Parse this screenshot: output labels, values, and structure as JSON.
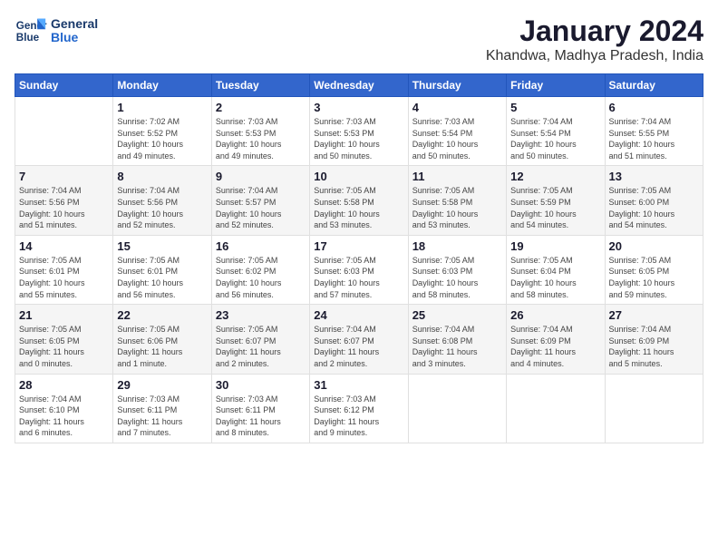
{
  "app": {
    "name": "GeneralBlue",
    "logo_line1": "General",
    "logo_line2": "Blue"
  },
  "calendar": {
    "month": "January 2024",
    "location": "Khandwa, Madhya Pradesh, India",
    "weekdays": [
      "Sunday",
      "Monday",
      "Tuesday",
      "Wednesday",
      "Thursday",
      "Friday",
      "Saturday"
    ],
    "weeks": [
      [
        {
          "day": "",
          "info": ""
        },
        {
          "day": "1",
          "info": "Sunrise: 7:02 AM\nSunset: 5:52 PM\nDaylight: 10 hours\nand 49 minutes."
        },
        {
          "day": "2",
          "info": "Sunrise: 7:03 AM\nSunset: 5:53 PM\nDaylight: 10 hours\nand 49 minutes."
        },
        {
          "day": "3",
          "info": "Sunrise: 7:03 AM\nSunset: 5:53 PM\nDaylight: 10 hours\nand 50 minutes."
        },
        {
          "day": "4",
          "info": "Sunrise: 7:03 AM\nSunset: 5:54 PM\nDaylight: 10 hours\nand 50 minutes."
        },
        {
          "day": "5",
          "info": "Sunrise: 7:04 AM\nSunset: 5:54 PM\nDaylight: 10 hours\nand 50 minutes."
        },
        {
          "day": "6",
          "info": "Sunrise: 7:04 AM\nSunset: 5:55 PM\nDaylight: 10 hours\nand 51 minutes."
        }
      ],
      [
        {
          "day": "7",
          "info": "Sunrise: 7:04 AM\nSunset: 5:56 PM\nDaylight: 10 hours\nand 51 minutes."
        },
        {
          "day": "8",
          "info": "Sunrise: 7:04 AM\nSunset: 5:56 PM\nDaylight: 10 hours\nand 52 minutes."
        },
        {
          "day": "9",
          "info": "Sunrise: 7:04 AM\nSunset: 5:57 PM\nDaylight: 10 hours\nand 52 minutes."
        },
        {
          "day": "10",
          "info": "Sunrise: 7:05 AM\nSunset: 5:58 PM\nDaylight: 10 hours\nand 53 minutes."
        },
        {
          "day": "11",
          "info": "Sunrise: 7:05 AM\nSunset: 5:58 PM\nDaylight: 10 hours\nand 53 minutes."
        },
        {
          "day": "12",
          "info": "Sunrise: 7:05 AM\nSunset: 5:59 PM\nDaylight: 10 hours\nand 54 minutes."
        },
        {
          "day": "13",
          "info": "Sunrise: 7:05 AM\nSunset: 6:00 PM\nDaylight: 10 hours\nand 54 minutes."
        }
      ],
      [
        {
          "day": "14",
          "info": "Sunrise: 7:05 AM\nSunset: 6:01 PM\nDaylight: 10 hours\nand 55 minutes."
        },
        {
          "day": "15",
          "info": "Sunrise: 7:05 AM\nSunset: 6:01 PM\nDaylight: 10 hours\nand 56 minutes."
        },
        {
          "day": "16",
          "info": "Sunrise: 7:05 AM\nSunset: 6:02 PM\nDaylight: 10 hours\nand 56 minutes."
        },
        {
          "day": "17",
          "info": "Sunrise: 7:05 AM\nSunset: 6:03 PM\nDaylight: 10 hours\nand 57 minutes."
        },
        {
          "day": "18",
          "info": "Sunrise: 7:05 AM\nSunset: 6:03 PM\nDaylight: 10 hours\nand 58 minutes."
        },
        {
          "day": "19",
          "info": "Sunrise: 7:05 AM\nSunset: 6:04 PM\nDaylight: 10 hours\nand 58 minutes."
        },
        {
          "day": "20",
          "info": "Sunrise: 7:05 AM\nSunset: 6:05 PM\nDaylight: 10 hours\nand 59 minutes."
        }
      ],
      [
        {
          "day": "21",
          "info": "Sunrise: 7:05 AM\nSunset: 6:05 PM\nDaylight: 11 hours\nand 0 minutes."
        },
        {
          "day": "22",
          "info": "Sunrise: 7:05 AM\nSunset: 6:06 PM\nDaylight: 11 hours\nand 1 minute."
        },
        {
          "day": "23",
          "info": "Sunrise: 7:05 AM\nSunset: 6:07 PM\nDaylight: 11 hours\nand 2 minutes."
        },
        {
          "day": "24",
          "info": "Sunrise: 7:04 AM\nSunset: 6:07 PM\nDaylight: 11 hours\nand 2 minutes."
        },
        {
          "day": "25",
          "info": "Sunrise: 7:04 AM\nSunset: 6:08 PM\nDaylight: 11 hours\nand 3 minutes."
        },
        {
          "day": "26",
          "info": "Sunrise: 7:04 AM\nSunset: 6:09 PM\nDaylight: 11 hours\nand 4 minutes."
        },
        {
          "day": "27",
          "info": "Sunrise: 7:04 AM\nSunset: 6:09 PM\nDaylight: 11 hours\nand 5 minutes."
        }
      ],
      [
        {
          "day": "28",
          "info": "Sunrise: 7:04 AM\nSunset: 6:10 PM\nDaylight: 11 hours\nand 6 minutes."
        },
        {
          "day": "29",
          "info": "Sunrise: 7:03 AM\nSunset: 6:11 PM\nDaylight: 11 hours\nand 7 minutes."
        },
        {
          "day": "30",
          "info": "Sunrise: 7:03 AM\nSunset: 6:11 PM\nDaylight: 11 hours\nand 8 minutes."
        },
        {
          "day": "31",
          "info": "Sunrise: 7:03 AM\nSunset: 6:12 PM\nDaylight: 11 hours\nand 9 minutes."
        },
        {
          "day": "",
          "info": ""
        },
        {
          "day": "",
          "info": ""
        },
        {
          "day": "",
          "info": ""
        }
      ]
    ]
  }
}
